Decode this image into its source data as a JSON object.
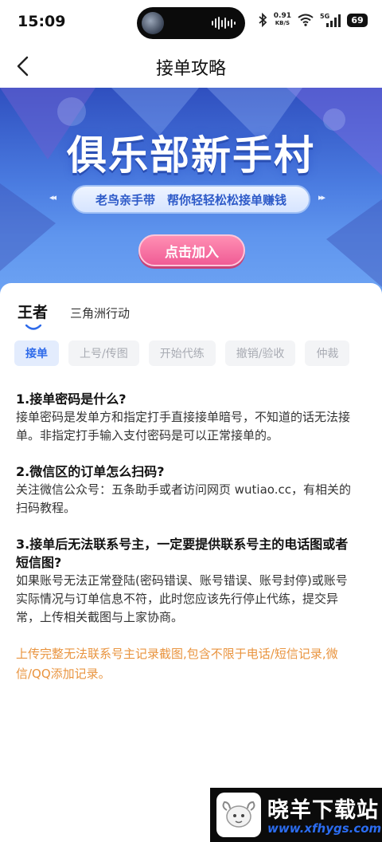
{
  "status_bar": {
    "time": "15:09",
    "net_speed_value": "0.91",
    "net_speed_unit": "KB/S",
    "cell_label": "5G",
    "battery": "69"
  },
  "header": {
    "title": "接单攻略",
    "back_icon": "chevron-left-icon"
  },
  "banner": {
    "title": "俱乐部新手村",
    "subtitle": "老鸟亲手带　帮你轻轻松松接单赚钱",
    "join_label": "点击加入",
    "arrows_left": "◂◂",
    "arrows_right": "▸▸"
  },
  "game_tabs": [
    {
      "label": "王者",
      "active": true
    },
    {
      "label": "三角洲行动",
      "active": false
    }
  ],
  "category_tabs": [
    {
      "label": "接单",
      "active": true
    },
    {
      "label": "上号/传图",
      "active": false
    },
    {
      "label": "开始代练",
      "active": false
    },
    {
      "label": "撤销/验收",
      "active": false
    },
    {
      "label": "仲裁",
      "active": false
    }
  ],
  "faq": [
    {
      "question": "1.接单密码是什么?",
      "answer": "接单密码是发单方和指定打手直接接单暗号，不知道的话无法接单。非指定打手输入支付密码是可以正常接单的。"
    },
    {
      "question": "2.微信区的订单怎么扫码?",
      "answer": "关注微信公众号：五条助手或者访问网页 wutiao.cc，有相关的扫码教程。"
    },
    {
      "question": "3.接单后无法联系号主，一定要提供联系号主的电话图或者短信图?",
      "answer": "如果账号无法正常登陆(密码错误、账号错误、账号封停)或账号实际情况与订单信息不符，此时您应该先行停止代练，提交异常，上传相关截图与上家协商。"
    }
  ],
  "notice": "上传完整无法联系号主记录截图,包含不限于电话/短信记录,微信/QQ添加记录。",
  "watermark": {
    "name": "晓羊下载站",
    "url": "www.xfhygs.com"
  },
  "colors": {
    "accent_blue": "#2f6bea",
    "notice_orange": "#e9943f",
    "join_pink": "#f05c95"
  }
}
